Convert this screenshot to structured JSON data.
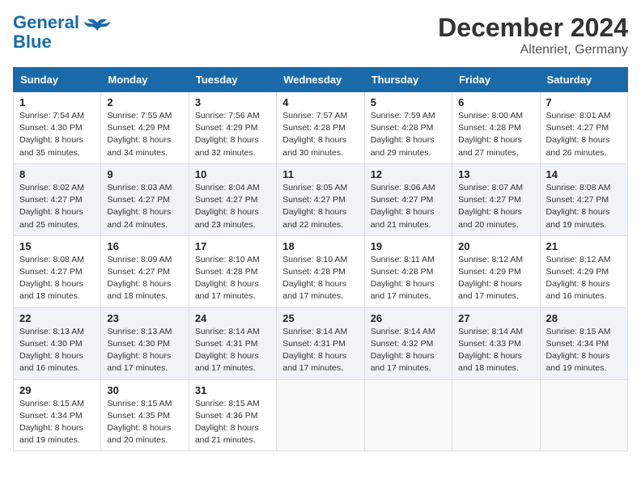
{
  "header": {
    "logo_line1": "General",
    "logo_line2": "Blue",
    "title": "December 2024",
    "subtitle": "Altenriet, Germany"
  },
  "days_of_week": [
    "Sunday",
    "Monday",
    "Tuesday",
    "Wednesday",
    "Thursday",
    "Friday",
    "Saturday"
  ],
  "weeks": [
    [
      {
        "day": "1",
        "sunrise": "7:54 AM",
        "sunset": "4:30 PM",
        "daylight": "8 hours and 35 minutes."
      },
      {
        "day": "2",
        "sunrise": "7:55 AM",
        "sunset": "4:29 PM",
        "daylight": "8 hours and 34 minutes."
      },
      {
        "day": "3",
        "sunrise": "7:56 AM",
        "sunset": "4:29 PM",
        "daylight": "8 hours and 32 minutes."
      },
      {
        "day": "4",
        "sunrise": "7:57 AM",
        "sunset": "4:28 PM",
        "daylight": "8 hours and 30 minutes."
      },
      {
        "day": "5",
        "sunrise": "7:59 AM",
        "sunset": "4:28 PM",
        "daylight": "8 hours and 29 minutes."
      },
      {
        "day": "6",
        "sunrise": "8:00 AM",
        "sunset": "4:28 PM",
        "daylight": "8 hours and 27 minutes."
      },
      {
        "day": "7",
        "sunrise": "8:01 AM",
        "sunset": "4:27 PM",
        "daylight": "8 hours and 26 minutes."
      }
    ],
    [
      {
        "day": "8",
        "sunrise": "8:02 AM",
        "sunset": "4:27 PM",
        "daylight": "8 hours and 25 minutes."
      },
      {
        "day": "9",
        "sunrise": "8:03 AM",
        "sunset": "4:27 PM",
        "daylight": "8 hours and 24 minutes."
      },
      {
        "day": "10",
        "sunrise": "8:04 AM",
        "sunset": "4:27 PM",
        "daylight": "8 hours and 23 minutes."
      },
      {
        "day": "11",
        "sunrise": "8:05 AM",
        "sunset": "4:27 PM",
        "daylight": "8 hours and 22 minutes."
      },
      {
        "day": "12",
        "sunrise": "8:06 AM",
        "sunset": "4:27 PM",
        "daylight": "8 hours and 21 minutes."
      },
      {
        "day": "13",
        "sunrise": "8:07 AM",
        "sunset": "4:27 PM",
        "daylight": "8 hours and 20 minutes."
      },
      {
        "day": "14",
        "sunrise": "8:08 AM",
        "sunset": "4:27 PM",
        "daylight": "8 hours and 19 minutes."
      }
    ],
    [
      {
        "day": "15",
        "sunrise": "8:08 AM",
        "sunset": "4:27 PM",
        "daylight": "8 hours and 18 minutes."
      },
      {
        "day": "16",
        "sunrise": "8:09 AM",
        "sunset": "4:27 PM",
        "daylight": "8 hours and 18 minutes."
      },
      {
        "day": "17",
        "sunrise": "8:10 AM",
        "sunset": "4:28 PM",
        "daylight": "8 hours and 17 minutes."
      },
      {
        "day": "18",
        "sunrise": "8:10 AM",
        "sunset": "4:28 PM",
        "daylight": "8 hours and 17 minutes."
      },
      {
        "day": "19",
        "sunrise": "8:11 AM",
        "sunset": "4:28 PM",
        "daylight": "8 hours and 17 minutes."
      },
      {
        "day": "20",
        "sunrise": "8:12 AM",
        "sunset": "4:29 PM",
        "daylight": "8 hours and 17 minutes."
      },
      {
        "day": "21",
        "sunrise": "8:12 AM",
        "sunset": "4:29 PM",
        "daylight": "8 hours and 16 minutes."
      }
    ],
    [
      {
        "day": "22",
        "sunrise": "8:13 AM",
        "sunset": "4:30 PM",
        "daylight": "8 hours and 16 minutes."
      },
      {
        "day": "23",
        "sunrise": "8:13 AM",
        "sunset": "4:30 PM",
        "daylight": "8 hours and 17 minutes."
      },
      {
        "day": "24",
        "sunrise": "8:14 AM",
        "sunset": "4:31 PM",
        "daylight": "8 hours and 17 minutes."
      },
      {
        "day": "25",
        "sunrise": "8:14 AM",
        "sunset": "4:31 PM",
        "daylight": "8 hours and 17 minutes."
      },
      {
        "day": "26",
        "sunrise": "8:14 AM",
        "sunset": "4:32 PM",
        "daylight": "8 hours and 17 minutes."
      },
      {
        "day": "27",
        "sunrise": "8:14 AM",
        "sunset": "4:33 PM",
        "daylight": "8 hours and 18 minutes."
      },
      {
        "day": "28",
        "sunrise": "8:15 AM",
        "sunset": "4:34 PM",
        "daylight": "8 hours and 19 minutes."
      }
    ],
    [
      {
        "day": "29",
        "sunrise": "8:15 AM",
        "sunset": "4:34 PM",
        "daylight": "8 hours and 19 minutes."
      },
      {
        "day": "30",
        "sunrise": "8:15 AM",
        "sunset": "4:35 PM",
        "daylight": "8 hours and 20 minutes."
      },
      {
        "day": "31",
        "sunrise": "8:15 AM",
        "sunset": "4:36 PM",
        "daylight": "8 hours and 21 minutes."
      },
      null,
      null,
      null,
      null
    ]
  ],
  "labels": {
    "sunrise": "Sunrise:",
    "sunset": "Sunset:",
    "daylight": "Daylight:"
  }
}
